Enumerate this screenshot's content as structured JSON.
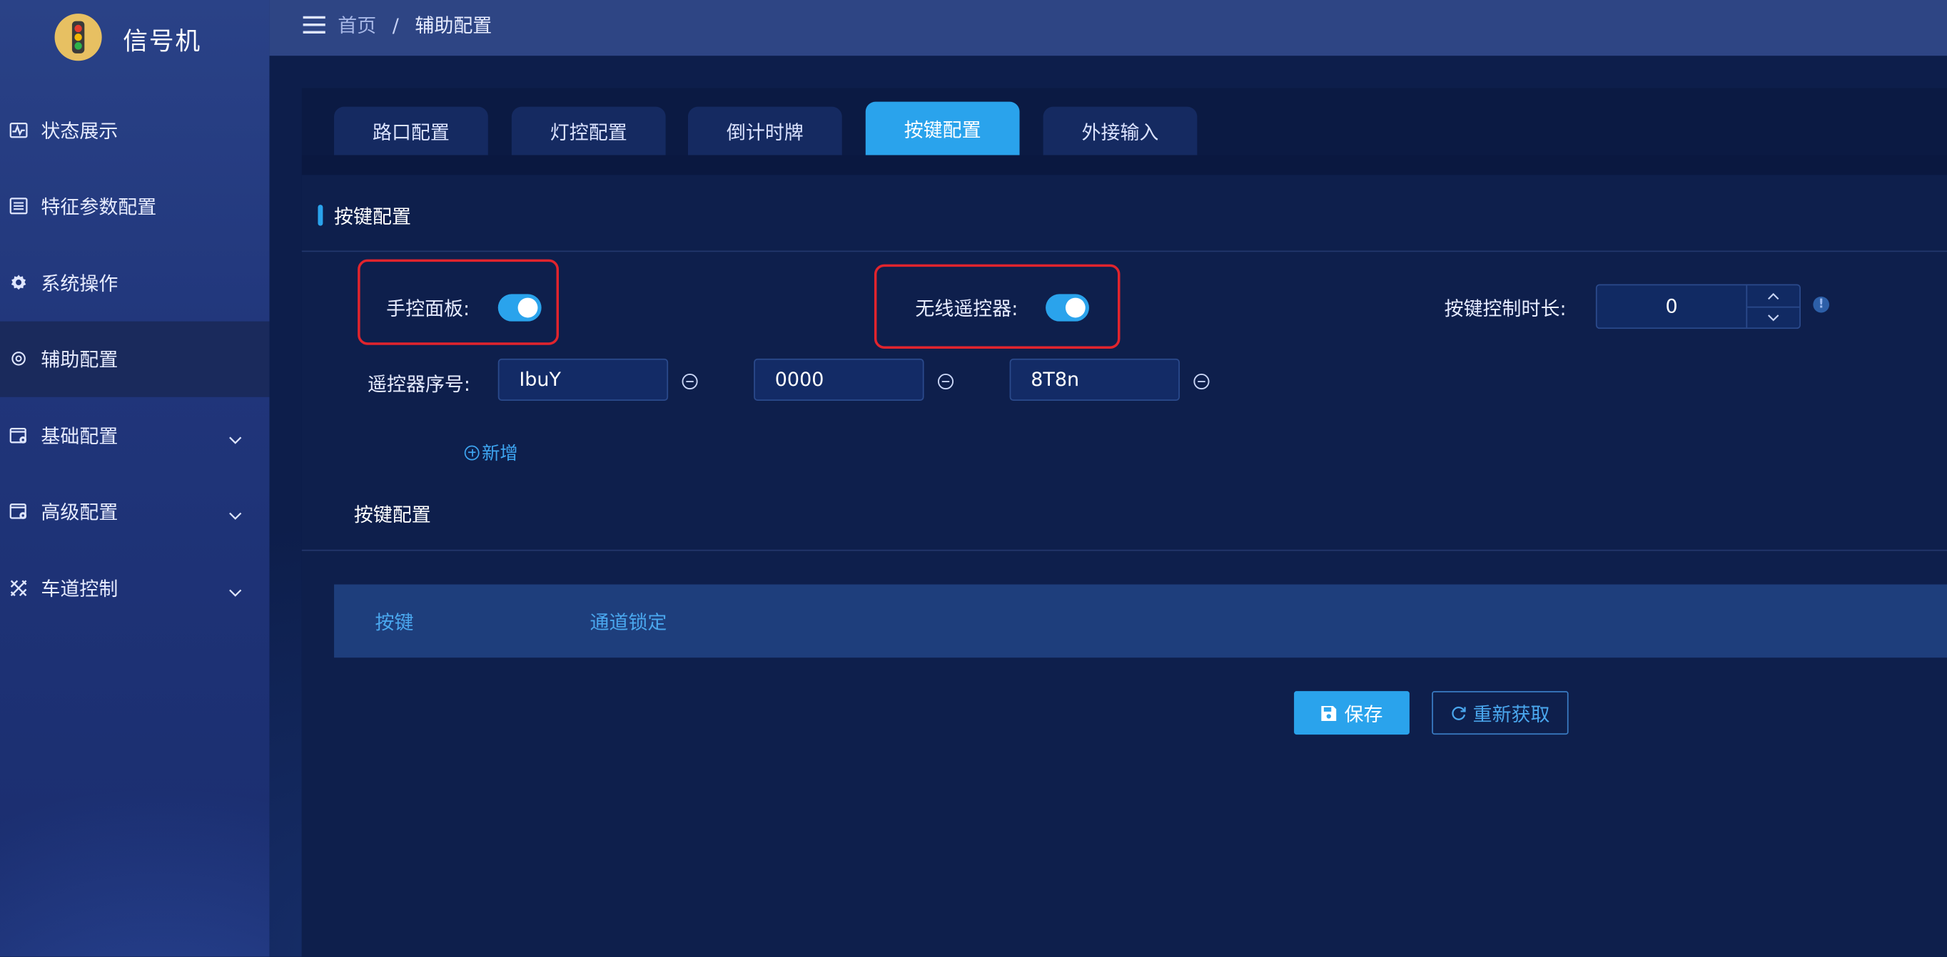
{
  "app": {
    "title": "信号机"
  },
  "sidebar": {
    "items": [
      {
        "label": "状态展示",
        "icon": "pulse-icon"
      },
      {
        "label": "特征参数配置",
        "icon": "list-icon"
      },
      {
        "label": "系统操作",
        "icon": "gear-icon"
      },
      {
        "label": "辅助配置",
        "icon": "settings-small-icon",
        "active": true
      },
      {
        "label": "基础配置",
        "icon": "window-gear-icon",
        "expandable": true
      },
      {
        "label": "高级配置",
        "icon": "window-gear-icon",
        "expandable": true
      },
      {
        "label": "车道控制",
        "icon": "crossed-icon",
        "expandable": true
      }
    ]
  },
  "breadcrumb": {
    "home": "首页",
    "sep": "/",
    "current": "辅助配置"
  },
  "tabs": [
    {
      "label": "路口配置"
    },
    {
      "label": "灯控配置"
    },
    {
      "label": "倒计时牌"
    },
    {
      "label": "按键配置",
      "active": true
    },
    {
      "label": "外接输入"
    }
  ],
  "section": {
    "title": "按键配置",
    "manual_panel": {
      "label": "手控面板:",
      "enabled": true
    },
    "wireless_remote": {
      "label": "无线遥控器:",
      "enabled": true
    },
    "duration": {
      "label": "按键控制时长:",
      "value": "0"
    },
    "remote_serial": {
      "label": "遥控器序号:",
      "values": [
        "IbuY",
        "0000",
        "8T8n"
      ]
    },
    "add_label": "新增",
    "sub_title": "按键配置"
  },
  "table": {
    "headers": [
      "按键",
      "通道锁定"
    ]
  },
  "actions": {
    "save": "保存",
    "refresh": "重新获取"
  },
  "colors": {
    "accent": "#2aa3ec",
    "highlight_border": "#e1242d",
    "sidebar_bg": "#20357a",
    "content_bg": "#0e1f4c"
  }
}
